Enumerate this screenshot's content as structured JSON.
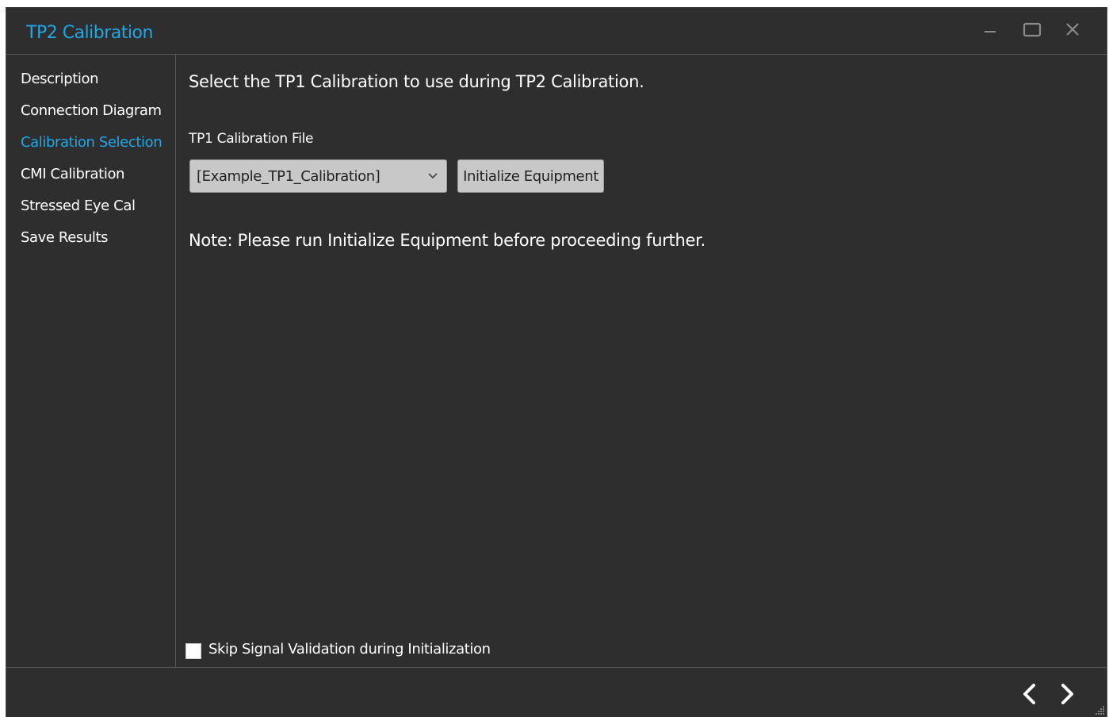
{
  "window": {
    "title": "TP2 Calibration",
    "accent_color": "#1fa7e6",
    "controls": [
      "minimize-icon",
      "maximize-icon",
      "close-icon"
    ]
  },
  "sidebar": {
    "items": [
      {
        "label": "Description",
        "active": false
      },
      {
        "label": "Connection Diagram",
        "active": false
      },
      {
        "label": "Calibration Selection",
        "active": true
      },
      {
        "label": "CMI Calibration",
        "active": false
      },
      {
        "label": "Stressed Eye Cal",
        "active": false
      },
      {
        "label": "Save Results",
        "active": false
      }
    ]
  },
  "main": {
    "heading": "Select the TP1 Calibration to use during TP2 Calibration.",
    "file_label": "TP1 Calibration File",
    "file_select": {
      "value": "[Example_TP1_Calibration]",
      "icon": "chevron-down-icon"
    },
    "init_button": "Initialize Equipment",
    "note": "Note: Please run Initialize Equipment before proceeding further.",
    "skip_validation": {
      "label": "Skip Signal Validation during Initialization",
      "checked": false
    }
  },
  "footer": {
    "prev_icon": "chevron-left-icon",
    "next_icon": "chevron-right-icon",
    "grip_icon": "resize-grip-icon"
  }
}
